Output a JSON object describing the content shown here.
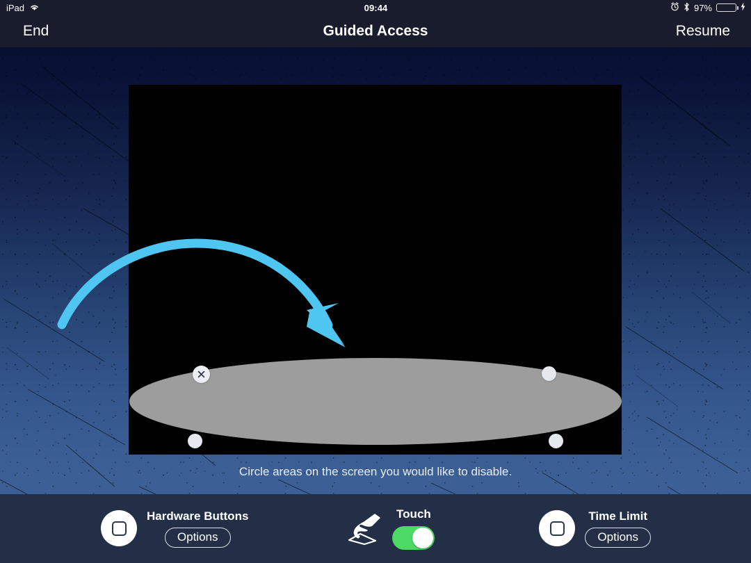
{
  "status_bar": {
    "device_label": "iPad",
    "wifi_icon": "wifi-icon",
    "time": "09:44",
    "alarm_icon": "alarm-clock-icon",
    "bluetooth_icon": "bluetooth-icon",
    "battery_percent": "97%",
    "battery_icon": "battery-icon",
    "charging_icon": "lightning-bolt-icon",
    "battery_fill_color": "#4cd964",
    "battery_level": 97
  },
  "nav_bar": {
    "left_button": "End",
    "title": "Guided Access",
    "right_button": "Resume",
    "background_color": "#181c2c"
  },
  "canvas": {
    "hint_text": "Circle areas on the screen you would like to disable.",
    "app_background_color": "#000000",
    "arrow": {
      "name": "curved-arrow-annotation",
      "color": "#4fc6f2"
    },
    "disabled_region": {
      "name": "disabled-area-ellipse",
      "shape": "ellipse",
      "fill_color": "#9d9d9d",
      "close_handle_glyph": "×",
      "handle_color": "#e6e8ef"
    }
  },
  "toolbar": {
    "background_color": "#222f47",
    "items": [
      {
        "name": "hardware-buttons",
        "label": "Hardware Buttons",
        "icon": "rounded-square-icon",
        "action_label": "Options",
        "control": "options"
      },
      {
        "name": "touch",
        "label": "Touch",
        "icon": "hand-touch-icon",
        "control": "toggle",
        "toggle_on": true,
        "toggle_color": "#4cd964"
      },
      {
        "name": "time-limit",
        "label": "Time Limit",
        "icon": "rounded-square-icon",
        "action_label": "Options",
        "control": "options"
      }
    ]
  }
}
